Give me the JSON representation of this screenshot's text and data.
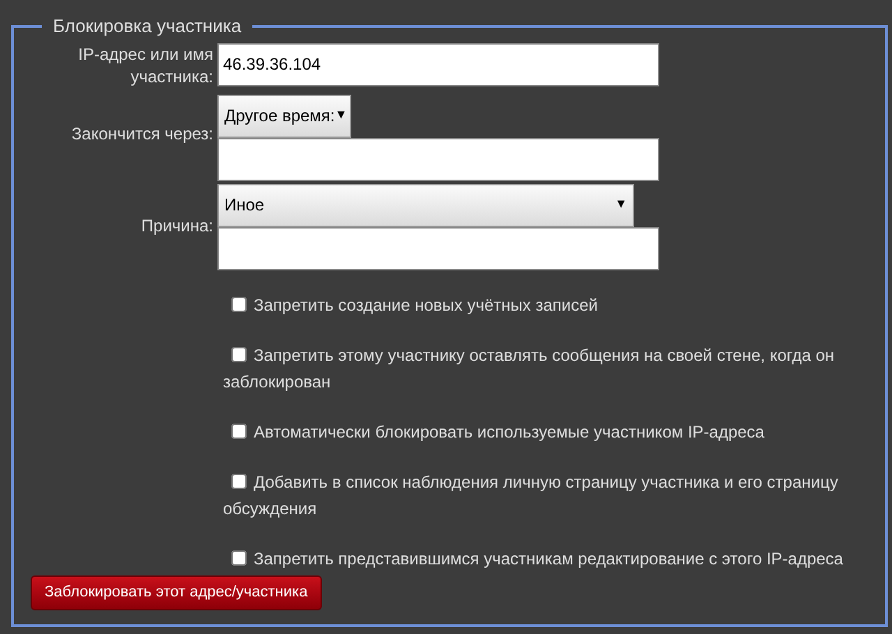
{
  "legend": "Блокировка участника",
  "ip_field": {
    "label": "IP-адрес или имя участника:",
    "value": "46.39.36.104"
  },
  "expiry": {
    "label": "Закончится через:",
    "select": "Другое время:",
    "arrow": "▼"
  },
  "reason": {
    "label": "Причина:",
    "select": "Иное",
    "arrow": "▼"
  },
  "options": [
    {
      "label": "Запретить создание новых учётных записей",
      "checked": false
    },
    {
      "label": "Запретить этому участнику оставлять сообщения на своей стене, когда он заблокирован",
      "checked": false
    },
    {
      "label": "Автоматически блокировать используемые участником IP-адреса",
      "checked": false
    },
    {
      "label": "Добавить в список наблюдения личную страницу участника и его страницу обсуждения",
      "checked": false
    },
    {
      "label": "Запретить представившимся участникам редактирование с этого IP-адреса",
      "checked": false
    }
  ],
  "submit": "Заблокировать этот адрес/участника"
}
